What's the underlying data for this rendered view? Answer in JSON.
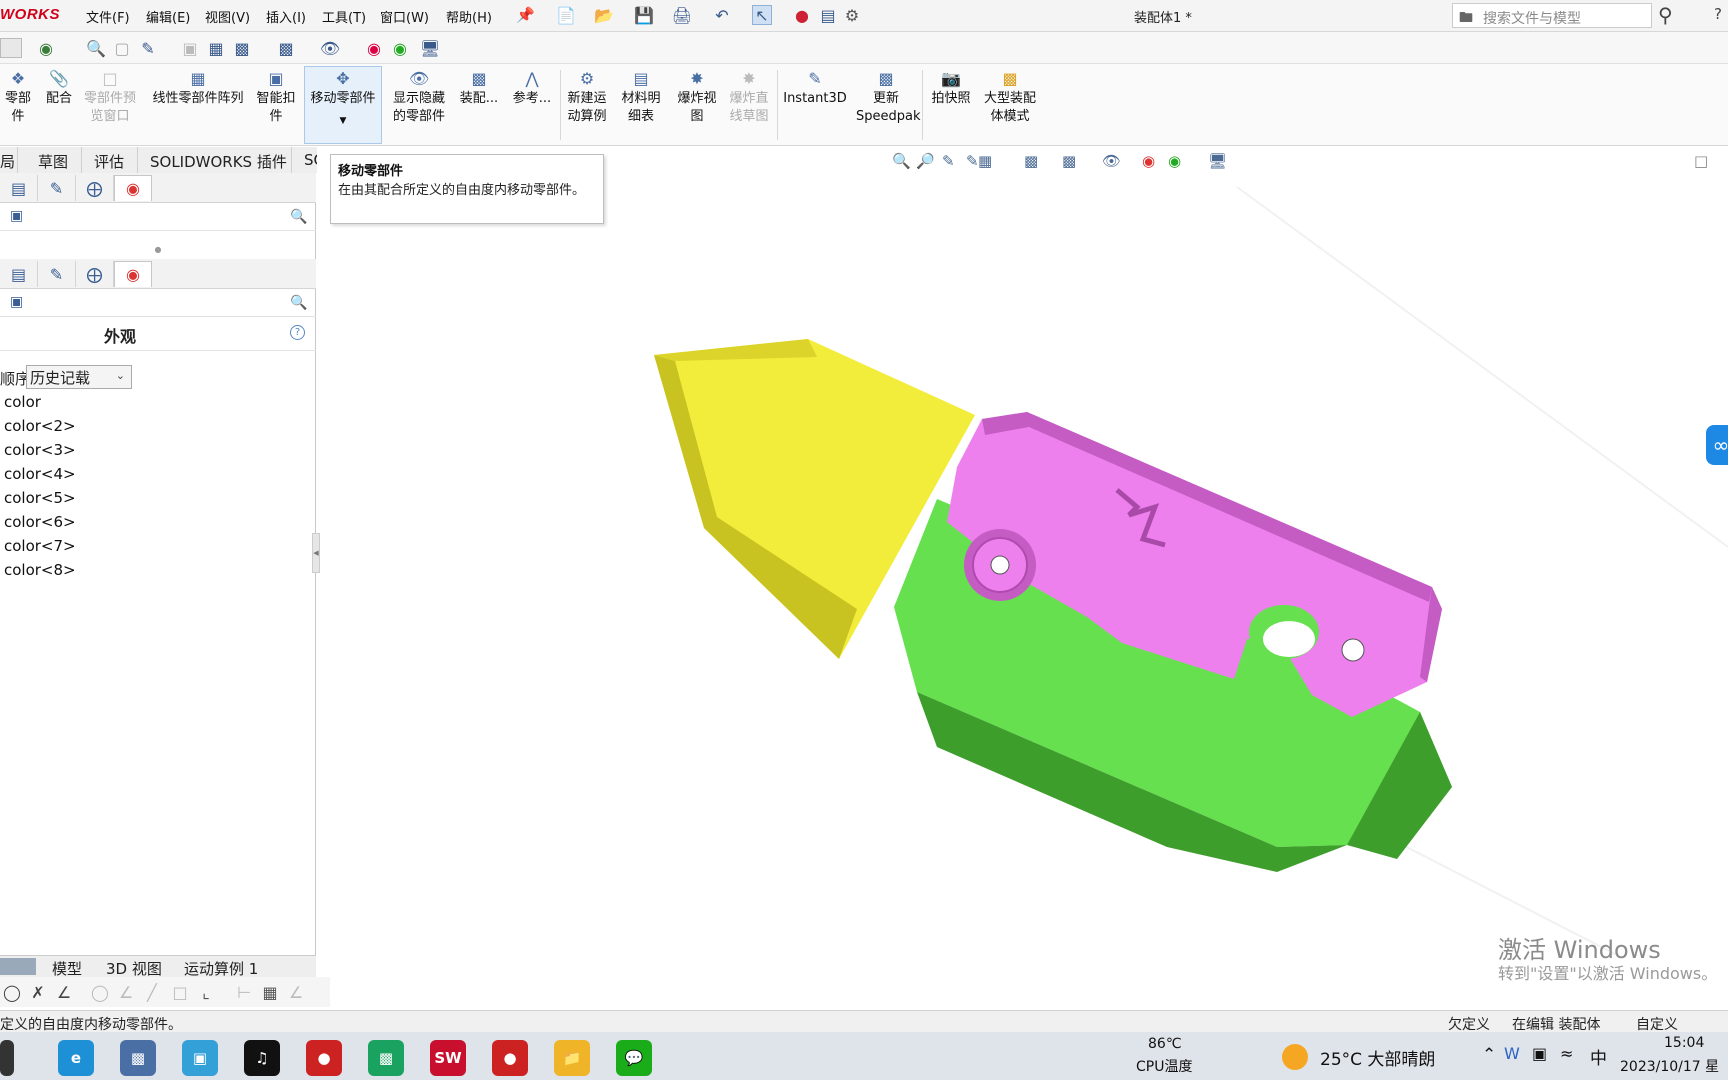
{
  "app": {
    "brand": "WORKS",
    "document_title": "装配体1 *"
  },
  "menu": [
    "文件(F)",
    "编辑(E)",
    "视图(V)",
    "插入(I)",
    "工具(T)",
    "窗口(W)",
    "帮助(H)"
  ],
  "search": {
    "placeholder": "搜索文件与模型"
  },
  "ribbon": {
    "items": [
      {
        "label": "零部件",
        "icon": "insert-component-icon"
      },
      {
        "label": "配合",
        "icon": "mate-icon"
      },
      {
        "label": "零部件预览窗口",
        "icon": "component-preview-icon",
        "disabled": true
      },
      {
        "label": "线性零部件阵列",
        "icon": "linear-pattern-icon"
      },
      {
        "label": "智能扣件",
        "icon": "smart-fastener-icon"
      },
      {
        "label": "移动零部件",
        "icon": "move-component-icon"
      },
      {
        "label": "显示隐藏的零部件",
        "icon": "show-hidden-icon"
      },
      {
        "label": "装配...",
        "icon": "assembly-features-icon"
      },
      {
        "label": "参考...",
        "icon": "reference-geometry-icon"
      },
      {
        "label": "新建运动算例",
        "icon": "new-motion-study-icon"
      },
      {
        "label": "材料明细表",
        "icon": "bom-icon"
      },
      {
        "label": "爆炸视图",
        "icon": "exploded-view-icon"
      },
      {
        "label": "爆炸直线草图",
        "icon": "explode-line-sketch-icon",
        "disabled": true
      },
      {
        "label": "Instant3D",
        "icon": "instant3d-icon"
      },
      {
        "label": "更新Speedpak",
        "icon": "speedpak-icon"
      },
      {
        "label": "拍快照",
        "icon": "snapshot-icon"
      },
      {
        "label": "大型装配体模式",
        "icon": "large-assembly-icon"
      }
    ]
  },
  "tabs": [
    "局",
    "草图",
    "评估",
    "SOLIDWORKS 插件",
    "SOL"
  ],
  "tooltip": {
    "title": "移动零部件",
    "description": "在由其配合所定义的自由度内移动零部件。"
  },
  "left_panel": {
    "title": "外观",
    "order_label": "顺序:",
    "order_value": "历史记载",
    "colors": [
      "color",
      "color<2>",
      "color<3>",
      "color<4>",
      "color<5>",
      "color<6>",
      "color<7>",
      "color<8>"
    ]
  },
  "bottom_tabs": [
    "模型",
    "3D 视图",
    "运动算例 1"
  ],
  "status": {
    "left": "定义的自由度内移动零部件。",
    "underdefined": "欠定义",
    "editing": "在编辑 装配体",
    "custom": "自定义"
  },
  "watermark": {
    "line1": "激活 Windows",
    "line2": "转到\"设置\"以激活 Windows。"
  },
  "taskbar": {
    "cpu_temp": "86℃",
    "cpu_label": "CPU温度",
    "weather": "25°C 大部晴朗",
    "ime": "中",
    "time": "15:04",
    "date": "2023/10/17 星"
  },
  "colors": {
    "yellow": "#f2ec3a",
    "yellow_dark": "#c9c322",
    "magenta": "#ee80ee",
    "magenta_dark": "#c45cc4",
    "green": "#66e04e",
    "green_dark": "#3d9e2c",
    "ribbon_highlight": "#e6f0fb"
  }
}
